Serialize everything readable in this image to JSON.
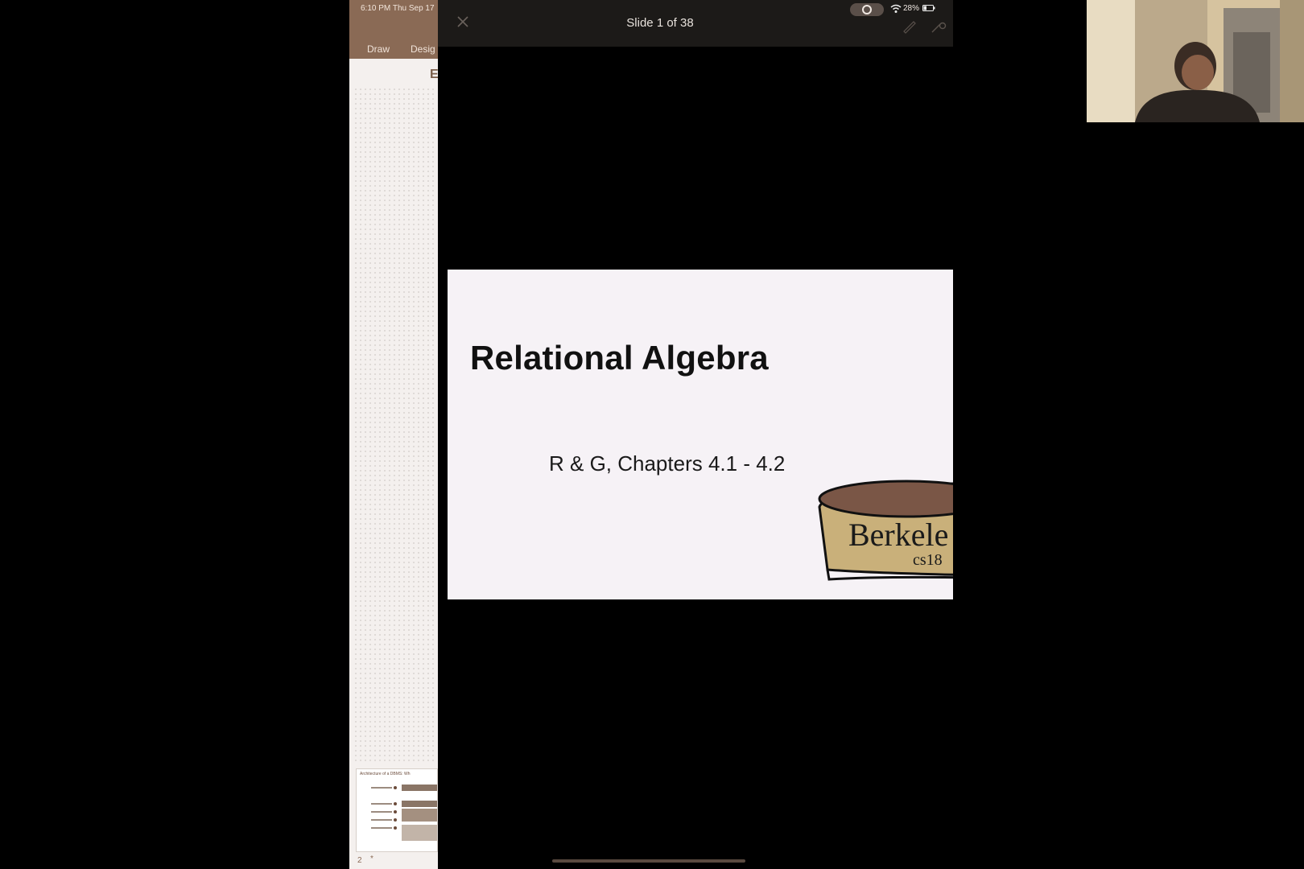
{
  "editor": {
    "status_time": "6:10 PM   Thu Sep 17",
    "tabs": [
      "Draw",
      "Desig"
    ],
    "partial_letter": "E",
    "thumbnail": {
      "title": "Architecture of a DBMS: Wh",
      "slide_number": "2",
      "star": "*"
    }
  },
  "presentation": {
    "slide_counter": "Slide 1 of 38",
    "battery": "28%",
    "icons": [
      "close-icon",
      "record-icon",
      "wifi-icon",
      "battery-icon",
      "pen-icon",
      "laser-pointer-icon"
    ],
    "slide": {
      "title": "Relational Algebra",
      "subtitle": "R & G, Chapters 4.1 - 4.2",
      "logo_text": "Berkele",
      "logo_subtext": "cs18"
    }
  },
  "webcam": {
    "description_icon": "person-video"
  },
  "colors": {
    "toolbar": "#8a6a55",
    "slide_bg": "#f6f2f6",
    "logo_gold": "#c9b07a",
    "logo_brown": "#7a5646"
  }
}
